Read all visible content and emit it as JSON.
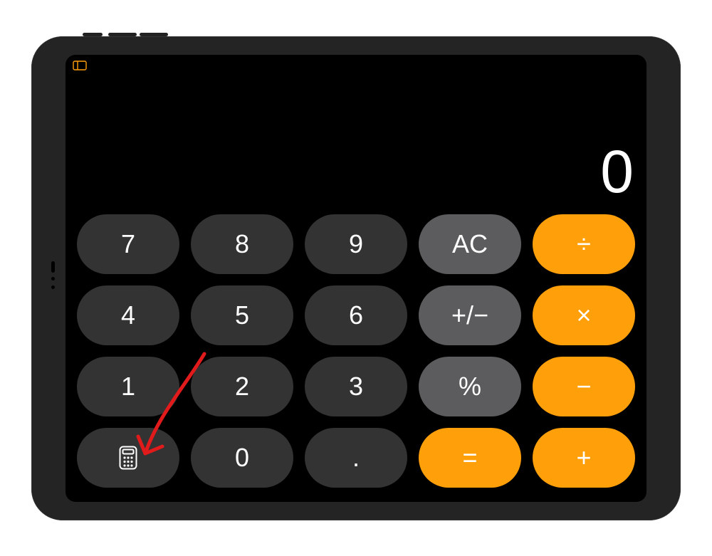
{
  "display": {
    "value": "0"
  },
  "keys": {
    "r1": {
      "a": "7",
      "b": "8",
      "c": "9",
      "d": "AC",
      "e": "÷"
    },
    "r2": {
      "a": "4",
      "b": "5",
      "c": "6",
      "d": "+/−",
      "e": "×"
    },
    "r3": {
      "a": "1",
      "b": "2",
      "c": "3",
      "d": "%",
      "e": "−"
    },
    "r4": {
      "a": "",
      "b": "0",
      "c": ".",
      "d": "=",
      "e": "+"
    }
  },
  "colors": {
    "operator": "#ff9f0a",
    "function": "#5c5c5e",
    "number": "#333333",
    "annotation": "#e11b1b"
  }
}
